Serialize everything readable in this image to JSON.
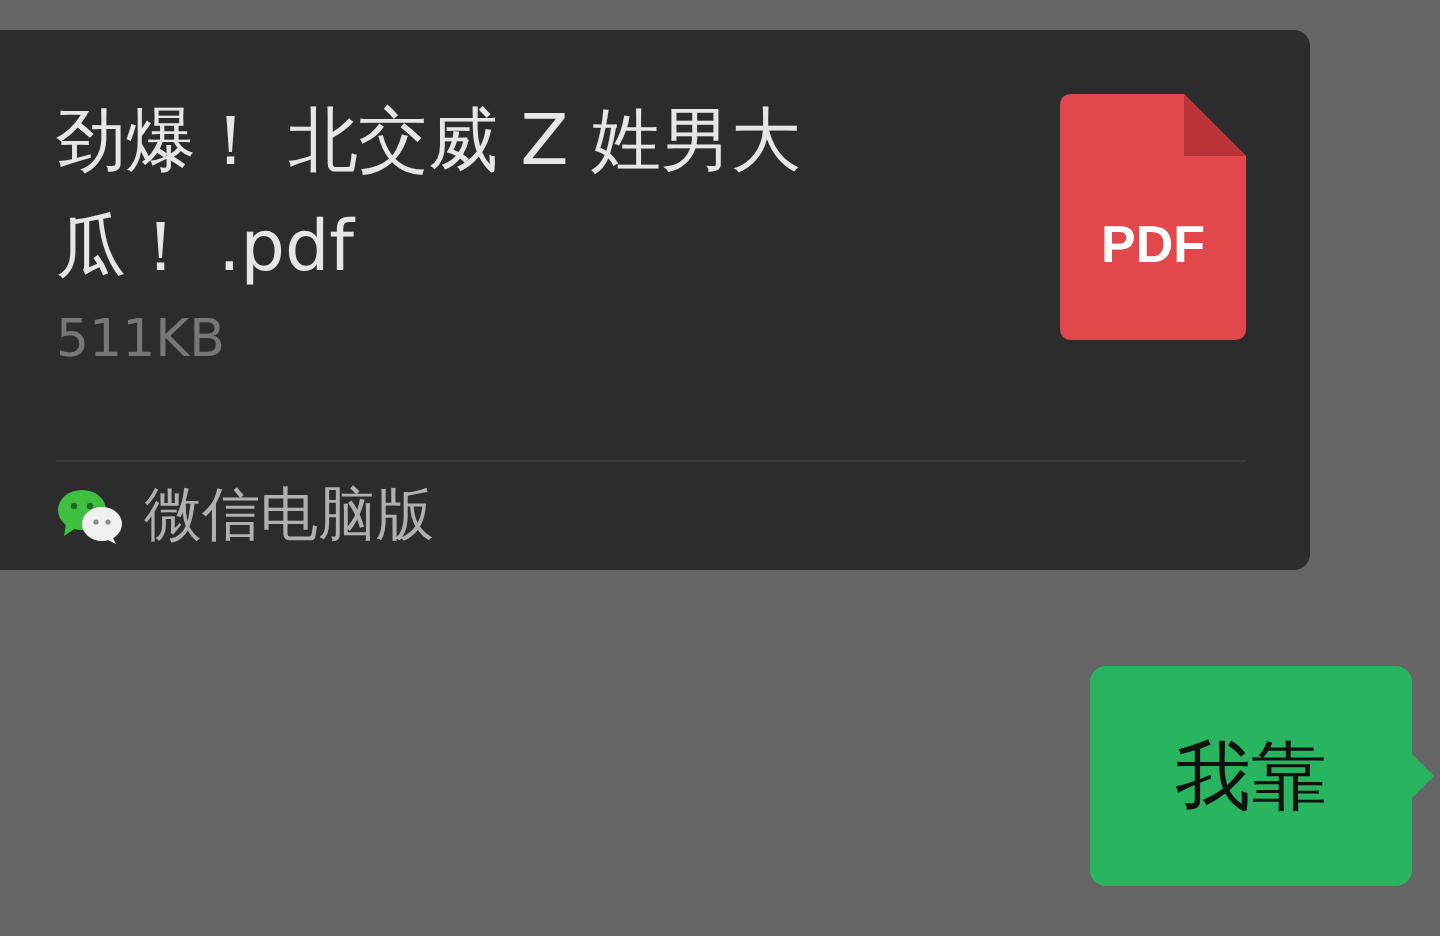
{
  "messages": [
    {
      "kind": "file",
      "outgoing": false,
      "file_name": "劲爆！ 北交威 Z 姓男大瓜！ .pdf",
      "file_size": "511KB",
      "file_badge": "PDF",
      "source": "微信电脑版"
    },
    {
      "kind": "text",
      "outgoing": true,
      "text": "我靠"
    }
  ]
}
